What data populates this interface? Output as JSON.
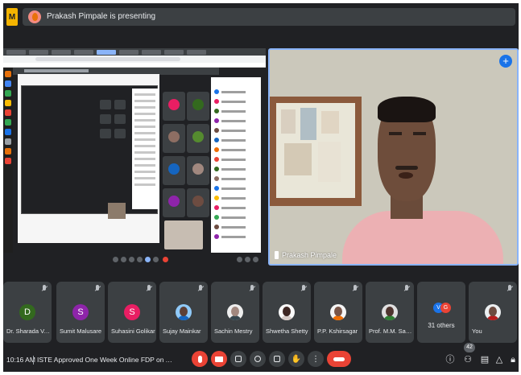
{
  "topbar": {
    "app_badge": "M",
    "presenting_text": "Prakash Pimpale is presenting"
  },
  "presenter": {
    "name": "Prakash Pimpale"
  },
  "participants": [
    {
      "name": "Dr. Sharada V. ...",
      "initial": "D",
      "color": "#33691e",
      "kind": "letter"
    },
    {
      "name": "Sumit Malusare",
      "initial": "S",
      "color": "#8e24aa",
      "kind": "letter"
    },
    {
      "name": "Suhasini Golikar",
      "initial": "S",
      "color": "#e91e63",
      "kind": "letter"
    },
    {
      "name": "Sujay Mainkar",
      "kind": "photo",
      "head": "#5d4037",
      "body": "#1565c0",
      "bg": "#90caf9"
    },
    {
      "name": "Sachin Mestry",
      "kind": "photo",
      "head": "#a1887f",
      "body": "#37474f",
      "bg": "#eeeeee"
    },
    {
      "name": "Shwetha Shetty",
      "kind": "photo",
      "head": "#3e2723",
      "body": "#d7ccc8",
      "bg": "#fafafa"
    },
    {
      "name": "P.P. Kshirsagar",
      "kind": "photo",
      "head": "#795548",
      "body": "#ef6c00",
      "bg": "#f5f5f5"
    },
    {
      "name": "Prof. M.M. Sam...",
      "kind": "photo",
      "head": "#4e342e",
      "body": "#2e7d32",
      "bg": "#e0e0e0"
    }
  ],
  "others": {
    "label": "31 others",
    "a1": "V",
    "a1_color": "#1a73e8",
    "a2": "G",
    "a2_color": "#ea4335"
  },
  "you": {
    "name": "You",
    "head": "#6d4c41",
    "body": "#b71c1c",
    "bg": "#eceff1"
  },
  "bottom": {
    "time": "10:16 AM",
    "title": "ISTE Approved One Week Online FDP on AI Algorith...",
    "participant_count": "42"
  },
  "colors": {
    "background": "#202124",
    "tile": "#3c4043",
    "accent": "#8ab4f8",
    "danger": "#ea4335"
  },
  "icons": {
    "mic": "mic-off-icon",
    "camera": "camera-off-icon",
    "captions": "captions-icon",
    "emoji": "emoji-icon",
    "present": "present-icon",
    "hand": "raise-hand-icon",
    "more": "more-options-icon",
    "leave": "leave-call-icon",
    "info": "info-icon",
    "people": "people-icon",
    "chat": "chat-icon",
    "activities": "activities-icon",
    "lock": "host-controls-icon"
  }
}
